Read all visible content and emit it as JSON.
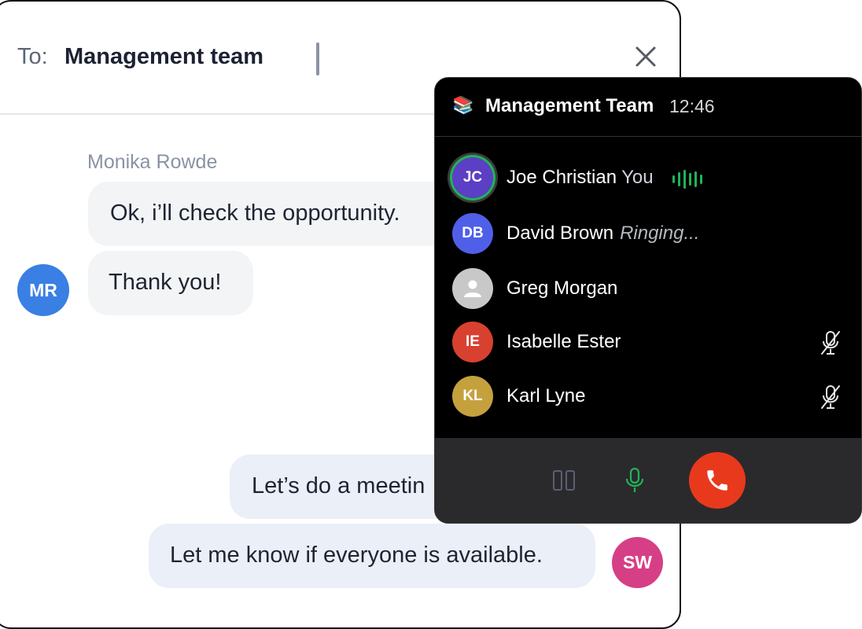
{
  "chat": {
    "to_label": "To:",
    "to_value": "Management team",
    "close_icon": "close-icon",
    "messages": [
      {
        "sender": "Monika Rowde",
        "text": "Ok, i’ll check the opportunity."
      },
      {
        "text": "Thank you!"
      },
      {
        "text": "Let’s do a meetin"
      },
      {
        "text": "Let me know if everyone is available."
      }
    ],
    "avatars": {
      "mr": {
        "initials": "MR",
        "color": "#3a7fe4"
      },
      "sw": {
        "initials": "SW",
        "color": "#d63f85"
      }
    }
  },
  "call": {
    "icon": "📚",
    "title": "Management Team",
    "timer": "12:46",
    "participants": [
      {
        "initials": "JC",
        "name": "Joe Christian",
        "tag": "You",
        "color": "#5b3fc4",
        "state": "speaking"
      },
      {
        "initials": "DB",
        "name": "David Brown",
        "status": "Ringing...",
        "color": "#4f5fe8"
      },
      {
        "initials": "",
        "name": "Greg Morgan",
        "color": "#c8c8c8",
        "icon": "user-placeholder-icon"
      },
      {
        "initials": "IE",
        "name": "Isabelle Ester",
        "color": "#d8412f",
        "muted": true
      },
      {
        "initials": "KL",
        "name": "Karl Lyne",
        "color": "#c5a13e",
        "muted": true
      }
    ],
    "controls": {
      "pause_icon": "pause-icon",
      "mic_icon": "microphone-icon",
      "end_icon": "end-call-icon"
    },
    "colors": {
      "active": "#1fb457",
      "end_call": "#e8391d",
      "footer": "#2a2a2c"
    }
  }
}
